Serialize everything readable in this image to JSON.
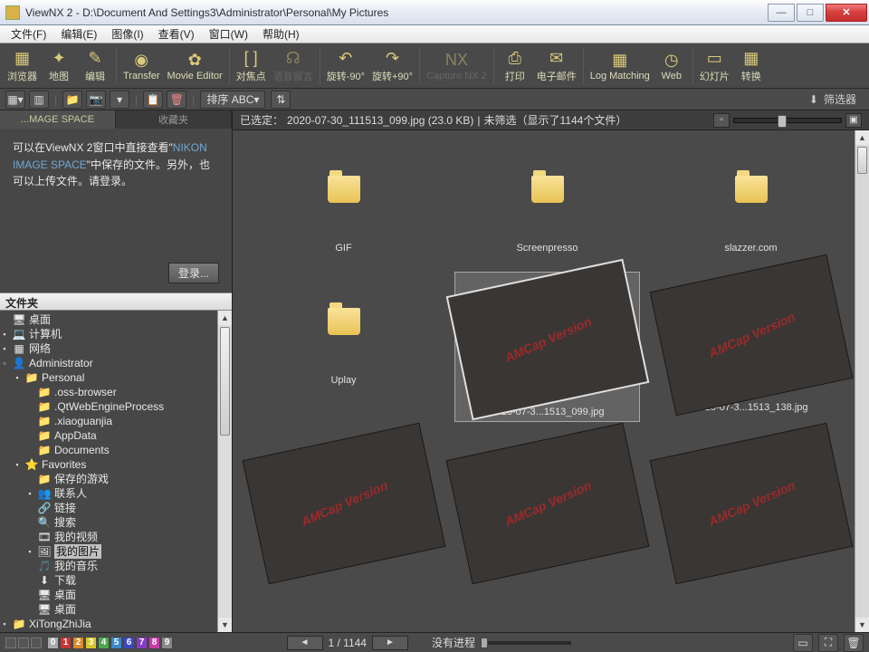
{
  "title": "ViewNX 2 - D:\\Document And Settings3\\Administrator\\Personal\\My Pictures",
  "menus": [
    "文件(F)",
    "编辑(E)",
    "图像(I)",
    "查看(V)",
    "窗口(W)",
    "帮助(H)"
  ],
  "toolbar": [
    {
      "label": "浏览器",
      "icon": "▦"
    },
    {
      "label": "地图",
      "icon": "✦"
    },
    {
      "label": "编辑",
      "icon": "✎"
    },
    {
      "label": "Transfer",
      "icon": "◉",
      "sep": true
    },
    {
      "label": "Movie Editor",
      "icon": "✿"
    },
    {
      "label": "对焦点",
      "icon": "[ ]",
      "sep": true
    },
    {
      "label": "语音留言",
      "icon": "☊",
      "disabled": true
    },
    {
      "label": "旋转-90°",
      "icon": "↶",
      "sep": true
    },
    {
      "label": "旋转+90°",
      "icon": "↷"
    },
    {
      "label": "Capture NX 2",
      "icon": "NX",
      "disabled": true,
      "sep": true
    },
    {
      "label": "打印",
      "icon": "⎙",
      "sep": true
    },
    {
      "label": "电子邮件",
      "icon": "✉"
    },
    {
      "label": "Log Matching",
      "icon": "▦",
      "sep": true
    },
    {
      "label": "Web",
      "icon": "◷"
    },
    {
      "label": "幻灯片",
      "icon": "▭",
      "sep": true
    },
    {
      "label": "转换",
      "icon": "▦"
    }
  ],
  "subtoolbar": {
    "sort_label": "排序 ABC",
    "filter_label": "筛选器"
  },
  "left": {
    "tab_active": "...MAGE SPACE",
    "tab_inactive": "收藏夹",
    "info_pre": "可以在ViewNX 2窗口中直接查看\"",
    "info_link": "NIKON IMAGE SPACE",
    "info_post": "\"中保存的文件。另外，也可以上传文件。请登录。",
    "login": "登录...",
    "folders_hdr": "文件夹",
    "tree": [
      {
        "pad": 0,
        "tw": "",
        "icon": "🖥",
        "label": "桌面",
        "color": "#4aa0e8"
      },
      {
        "pad": 0,
        "tw": "▪",
        "icon": "💻",
        "label": "计算机"
      },
      {
        "pad": 0,
        "tw": "▪",
        "icon": "▦",
        "label": "网络"
      },
      {
        "pad": 0,
        "tw": "▫",
        "icon": "👤",
        "label": "Administrator"
      },
      {
        "pad": 1,
        "tw": "▪",
        "icon": "📁",
        "label": "Personal"
      },
      {
        "pad": 2,
        "tw": "",
        "icon": "📁",
        "label": ".oss-browser"
      },
      {
        "pad": 2,
        "tw": "",
        "icon": "📁",
        "label": ".QtWebEngineProcess"
      },
      {
        "pad": 2,
        "tw": "",
        "icon": "📁",
        "label": ".xiaoguanjia"
      },
      {
        "pad": 2,
        "tw": "",
        "icon": "📁",
        "label": "AppData"
      },
      {
        "pad": 2,
        "tw": "",
        "icon": "📁",
        "label": "Documents"
      },
      {
        "pad": 1,
        "tw": "▪",
        "icon": "⭐",
        "label": "Favorites"
      },
      {
        "pad": 2,
        "tw": "",
        "icon": "📁",
        "label": "保存的游戏"
      },
      {
        "pad": 2,
        "tw": "▪",
        "icon": "👥",
        "label": "联系人"
      },
      {
        "pad": 2,
        "tw": "",
        "icon": "🔗",
        "label": "链接"
      },
      {
        "pad": 2,
        "tw": "",
        "icon": "🔍",
        "label": "搜索"
      },
      {
        "pad": 2,
        "tw": "",
        "icon": "🎞",
        "label": "我的视频"
      },
      {
        "pad": 2,
        "tw": "▪",
        "icon": "🖼",
        "label": "我的图片",
        "selected": true
      },
      {
        "pad": 2,
        "tw": "",
        "icon": "🎵",
        "label": "我的音乐"
      },
      {
        "pad": 2,
        "tw": "",
        "icon": "⬇",
        "label": "下载"
      },
      {
        "pad": 2,
        "tw": "",
        "icon": "🖥",
        "label": "桌面"
      },
      {
        "pad": 2,
        "tw": "",
        "icon": "🖥",
        "label": "桌面"
      },
      {
        "pad": 0,
        "tw": "▪",
        "icon": "📁",
        "label": "XiTongZhiJia"
      }
    ]
  },
  "content": {
    "sel_prefix": "已选定：",
    "sel_file": "2020-07-30_111513_099.jpg (23.0 KB)",
    "sel_sep": " | ",
    "filter_status": "未筛选（显示了1144个文件）",
    "folders": [
      "GIF",
      "Screenpresso",
      "slazzer.com",
      "Uplay"
    ],
    "images": [
      {
        "label": "2020-07-3...1513_099.jpg",
        "selected": true
      },
      {
        "label": "2020-07-3...1513_138.jpg"
      }
    ],
    "watermark": "AMCap Version"
  },
  "bottom": {
    "pager": "1 / 1144",
    "progress_label": "没有进程"
  }
}
